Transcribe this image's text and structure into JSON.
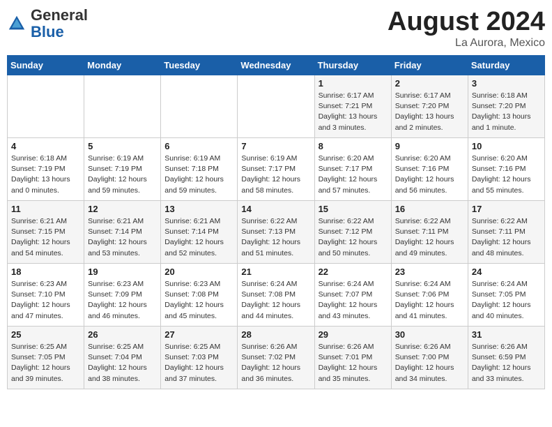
{
  "header": {
    "logo_general": "General",
    "logo_blue": "Blue",
    "month_year": "August 2024",
    "location": "La Aurora, Mexico"
  },
  "days_of_week": [
    "Sunday",
    "Monday",
    "Tuesday",
    "Wednesday",
    "Thursday",
    "Friday",
    "Saturday"
  ],
  "weeks": [
    [
      {
        "day": "",
        "info": ""
      },
      {
        "day": "",
        "info": ""
      },
      {
        "day": "",
        "info": ""
      },
      {
        "day": "",
        "info": ""
      },
      {
        "day": "1",
        "info": "Sunrise: 6:17 AM\nSunset: 7:21 PM\nDaylight: 13 hours\nand 3 minutes."
      },
      {
        "day": "2",
        "info": "Sunrise: 6:17 AM\nSunset: 7:20 PM\nDaylight: 13 hours\nand 2 minutes."
      },
      {
        "day": "3",
        "info": "Sunrise: 6:18 AM\nSunset: 7:20 PM\nDaylight: 13 hours\nand 1 minute."
      }
    ],
    [
      {
        "day": "4",
        "info": "Sunrise: 6:18 AM\nSunset: 7:19 PM\nDaylight: 13 hours\nand 0 minutes."
      },
      {
        "day": "5",
        "info": "Sunrise: 6:19 AM\nSunset: 7:19 PM\nDaylight: 12 hours\nand 59 minutes."
      },
      {
        "day": "6",
        "info": "Sunrise: 6:19 AM\nSunset: 7:18 PM\nDaylight: 12 hours\nand 59 minutes."
      },
      {
        "day": "7",
        "info": "Sunrise: 6:19 AM\nSunset: 7:17 PM\nDaylight: 12 hours\nand 58 minutes."
      },
      {
        "day": "8",
        "info": "Sunrise: 6:20 AM\nSunset: 7:17 PM\nDaylight: 12 hours\nand 57 minutes."
      },
      {
        "day": "9",
        "info": "Sunrise: 6:20 AM\nSunset: 7:16 PM\nDaylight: 12 hours\nand 56 minutes."
      },
      {
        "day": "10",
        "info": "Sunrise: 6:20 AM\nSunset: 7:16 PM\nDaylight: 12 hours\nand 55 minutes."
      }
    ],
    [
      {
        "day": "11",
        "info": "Sunrise: 6:21 AM\nSunset: 7:15 PM\nDaylight: 12 hours\nand 54 minutes."
      },
      {
        "day": "12",
        "info": "Sunrise: 6:21 AM\nSunset: 7:14 PM\nDaylight: 12 hours\nand 53 minutes."
      },
      {
        "day": "13",
        "info": "Sunrise: 6:21 AM\nSunset: 7:14 PM\nDaylight: 12 hours\nand 52 minutes."
      },
      {
        "day": "14",
        "info": "Sunrise: 6:22 AM\nSunset: 7:13 PM\nDaylight: 12 hours\nand 51 minutes."
      },
      {
        "day": "15",
        "info": "Sunrise: 6:22 AM\nSunset: 7:12 PM\nDaylight: 12 hours\nand 50 minutes."
      },
      {
        "day": "16",
        "info": "Sunrise: 6:22 AM\nSunset: 7:11 PM\nDaylight: 12 hours\nand 49 minutes."
      },
      {
        "day": "17",
        "info": "Sunrise: 6:22 AM\nSunset: 7:11 PM\nDaylight: 12 hours\nand 48 minutes."
      }
    ],
    [
      {
        "day": "18",
        "info": "Sunrise: 6:23 AM\nSunset: 7:10 PM\nDaylight: 12 hours\nand 47 minutes."
      },
      {
        "day": "19",
        "info": "Sunrise: 6:23 AM\nSunset: 7:09 PM\nDaylight: 12 hours\nand 46 minutes."
      },
      {
        "day": "20",
        "info": "Sunrise: 6:23 AM\nSunset: 7:08 PM\nDaylight: 12 hours\nand 45 minutes."
      },
      {
        "day": "21",
        "info": "Sunrise: 6:24 AM\nSunset: 7:08 PM\nDaylight: 12 hours\nand 44 minutes."
      },
      {
        "day": "22",
        "info": "Sunrise: 6:24 AM\nSunset: 7:07 PM\nDaylight: 12 hours\nand 43 minutes."
      },
      {
        "day": "23",
        "info": "Sunrise: 6:24 AM\nSunset: 7:06 PM\nDaylight: 12 hours\nand 41 minutes."
      },
      {
        "day": "24",
        "info": "Sunrise: 6:24 AM\nSunset: 7:05 PM\nDaylight: 12 hours\nand 40 minutes."
      }
    ],
    [
      {
        "day": "25",
        "info": "Sunrise: 6:25 AM\nSunset: 7:05 PM\nDaylight: 12 hours\nand 39 minutes."
      },
      {
        "day": "26",
        "info": "Sunrise: 6:25 AM\nSunset: 7:04 PM\nDaylight: 12 hours\nand 38 minutes."
      },
      {
        "day": "27",
        "info": "Sunrise: 6:25 AM\nSunset: 7:03 PM\nDaylight: 12 hours\nand 37 minutes."
      },
      {
        "day": "28",
        "info": "Sunrise: 6:26 AM\nSunset: 7:02 PM\nDaylight: 12 hours\nand 36 minutes."
      },
      {
        "day": "29",
        "info": "Sunrise: 6:26 AM\nSunset: 7:01 PM\nDaylight: 12 hours\nand 35 minutes."
      },
      {
        "day": "30",
        "info": "Sunrise: 6:26 AM\nSunset: 7:00 PM\nDaylight: 12 hours\nand 34 minutes."
      },
      {
        "day": "31",
        "info": "Sunrise: 6:26 AM\nSunset: 6:59 PM\nDaylight: 12 hours\nand 33 minutes."
      }
    ]
  ]
}
